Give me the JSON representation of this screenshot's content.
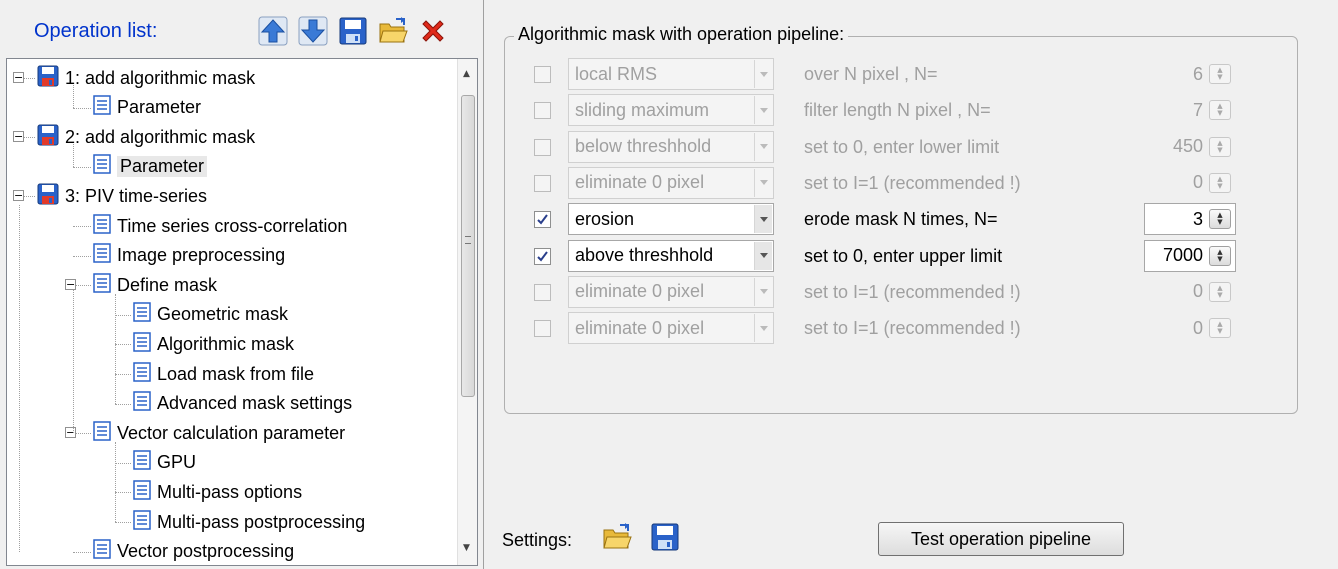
{
  "operation_list": {
    "title": "Operation list:",
    "toolbar": [
      "move-up-icon",
      "move-down-icon",
      "save-icon",
      "open-folder-icon",
      "delete-icon"
    ],
    "tree": [
      {
        "label": "1: add algorithmic mask",
        "icon": "disk-icon",
        "level": 0,
        "expander": "−"
      },
      {
        "label": "Parameter",
        "icon": "document-icon",
        "level": 1
      },
      {
        "label": "2: add algorithmic mask",
        "icon": "disk-icon",
        "level": 0,
        "expander": "−"
      },
      {
        "label": "Parameter",
        "icon": "document-icon",
        "level": 1,
        "selected": true
      },
      {
        "label": "3: PIV time-series",
        "icon": "disk-icon",
        "level": 0,
        "expander": "−"
      },
      {
        "label": "Time series cross-correlation",
        "icon": "document-icon",
        "level": 1
      },
      {
        "label": "Image preprocessing",
        "icon": "document-icon",
        "level": 1
      },
      {
        "label": "Define mask",
        "icon": "document-icon",
        "level": 1,
        "expander": "−"
      },
      {
        "label": "Geometric mask",
        "icon": "document-icon",
        "level": 2
      },
      {
        "label": "Algorithmic mask",
        "icon": "document-icon",
        "level": 2
      },
      {
        "label": "Load mask from file",
        "icon": "document-icon",
        "level": 2
      },
      {
        "label": "Advanced mask settings",
        "icon": "document-icon",
        "level": 2
      },
      {
        "label": "Vector calculation parameter",
        "icon": "document-icon",
        "level": 1,
        "expander": "−"
      },
      {
        "label": "GPU",
        "icon": "document-icon",
        "level": 2
      },
      {
        "label": "Multi-pass options",
        "icon": "document-icon",
        "level": 2
      },
      {
        "label": "Multi-pass postprocessing",
        "icon": "document-icon",
        "level": 2
      },
      {
        "label": "Vector postprocessing",
        "icon": "document-icon",
        "level": 1
      }
    ]
  },
  "pipeline": {
    "title": "Algorithmic mask with operation pipeline:",
    "rows": [
      {
        "checked": false,
        "enabled": false,
        "operation": "local RMS",
        "description": "over N pixel , N=",
        "value": "6"
      },
      {
        "checked": false,
        "enabled": false,
        "operation": "sliding maximum",
        "description": "filter length N pixel , N=",
        "value": "7"
      },
      {
        "checked": false,
        "enabled": false,
        "operation": "below threshhold",
        "description": "set to 0, enter lower limit",
        "value": "450"
      },
      {
        "checked": false,
        "enabled": false,
        "operation": "eliminate 0 pixel",
        "description": "set to I=1 (recommended !)",
        "value": "0"
      },
      {
        "checked": true,
        "enabled": true,
        "operation": "erosion",
        "description": "erode mask N times, N=",
        "value": "3"
      },
      {
        "checked": true,
        "enabled": true,
        "operation": "above threshhold",
        "description": "set to 0, enter upper limit",
        "value": "7000"
      },
      {
        "checked": false,
        "enabled": false,
        "operation": "eliminate 0 pixel",
        "description": "set to I=1 (recommended !)",
        "value": "0"
      },
      {
        "checked": false,
        "enabled": false,
        "operation": "eliminate 0 pixel",
        "description": "set to I=1 (recommended !)",
        "value": "0"
      }
    ]
  },
  "settings": {
    "label": "Settings:",
    "icons": [
      "open-folder-icon",
      "save-icon"
    ],
    "test_button": "Test operation pipeline"
  }
}
